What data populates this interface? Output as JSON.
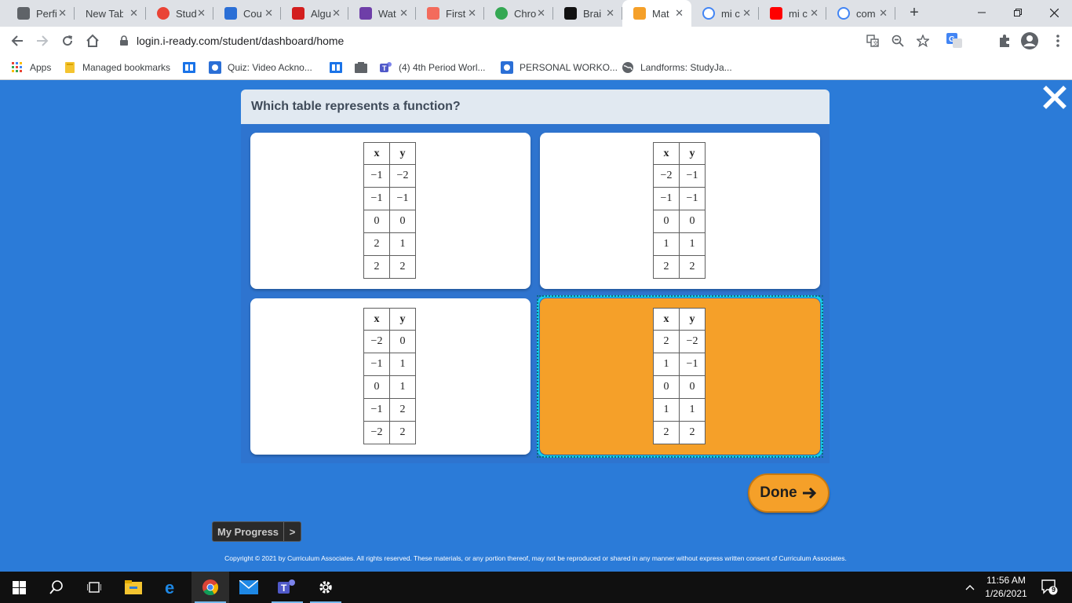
{
  "browser": {
    "tabs": [
      {
        "title": "Perfi",
        "icon": "generic-page-icon",
        "color": "#5f6368"
      },
      {
        "title": "New Tab",
        "icon": "none",
        "color": "#5f6368"
      },
      {
        "title": "Stud",
        "icon": "chrome-icon",
        "color": "#ea4335"
      },
      {
        "title": "Cou",
        "icon": "drive-icon",
        "color": "#2b6fd6"
      },
      {
        "title": "Algu",
        "icon": "telemundo-icon",
        "color": "#d31e1e"
      },
      {
        "title": "Wat",
        "icon": "nbc-icon",
        "color": "#6e3ea8"
      },
      {
        "title": "First",
        "icon": "dots-icon",
        "color": "#f36b5c"
      },
      {
        "title": "Chro",
        "icon": "chrome-icon",
        "color": "#34a853"
      },
      {
        "title": "Brai",
        "icon": "brainly-icon",
        "color": "#111111"
      },
      {
        "title": "Mat",
        "icon": "iready-cube-icon",
        "color": "#f5a029"
      },
      {
        "title": "mi c",
        "icon": "google-icon",
        "color": "#4285f4"
      },
      {
        "title": "mi c",
        "icon": "youtube-icon",
        "color": "#ff0000"
      },
      {
        "title": "com",
        "icon": "google-icon",
        "color": "#4285f4"
      }
    ],
    "active_tab_index": 9,
    "url": "login.i-ready.com/student/dashboard/home",
    "bookmarks": [
      {
        "label": "Apps",
        "icon": "apps-grid-icon"
      },
      {
        "label": "Managed bookmarks",
        "icon": "folder-icon"
      },
      {
        "label": "",
        "icon": "blue-book-icon"
      },
      {
        "label": "Quiz: Video Ackno...",
        "icon": "drive-icon"
      },
      {
        "label": "",
        "icon": "blue-book-icon"
      },
      {
        "label": "",
        "icon": "puzzle-folder-icon"
      },
      {
        "label": "(4) 4th Period Worl...",
        "icon": "teams-icon"
      },
      {
        "label": "PERSONAL WORKO...",
        "icon": "drive-icon"
      },
      {
        "label": "Landforms: StudyJa...",
        "icon": "globe-icon"
      }
    ]
  },
  "question": {
    "prompt": "Which table represents a function?"
  },
  "choices": [
    {
      "header": [
        "x",
        "y"
      ],
      "rows": [
        [
          "−1",
          "−2"
        ],
        [
          "−1",
          "−1"
        ],
        [
          "0",
          "0"
        ],
        [
          "2",
          "1"
        ],
        [
          "2",
          "2"
        ]
      ],
      "selected": false
    },
    {
      "header": [
        "x",
        "y"
      ],
      "rows": [
        [
          "−2",
          "−1"
        ],
        [
          "−1",
          "−1"
        ],
        [
          "0",
          "0"
        ],
        [
          "1",
          "1"
        ],
        [
          "2",
          "2"
        ]
      ],
      "selected": false
    },
    {
      "header": [
        "x",
        "y"
      ],
      "rows": [
        [
          "−2",
          "0"
        ],
        [
          "−1",
          "1"
        ],
        [
          "0",
          "1"
        ],
        [
          "−1",
          "2"
        ],
        [
          "−2",
          "2"
        ]
      ],
      "selected": false
    },
    {
      "header": [
        "x",
        "y"
      ],
      "rows": [
        [
          "2",
          "−2"
        ],
        [
          "1",
          "−1"
        ],
        [
          "0",
          "0"
        ],
        [
          "1",
          "1"
        ],
        [
          "2",
          "2"
        ]
      ],
      "selected": true
    }
  ],
  "done_label": "Done",
  "progress": {
    "label": "My Progress",
    "arrow": ">"
  },
  "copyright": "Copyright © 2021 by Curriculum Associates. All rights reserved. These materials, or any portion thereof, may not be reproduced or shared in any manner without express written consent of Curriculum Associates.",
  "taskbar": {
    "time": "11:56 AM",
    "date": "1/26/2021",
    "notification_count": "9"
  },
  "colors": {
    "app_background": "#2b7bd8",
    "selected_card": "#f5a029",
    "selection_outline": "#17d0e8",
    "done_button": "#f5a029"
  }
}
